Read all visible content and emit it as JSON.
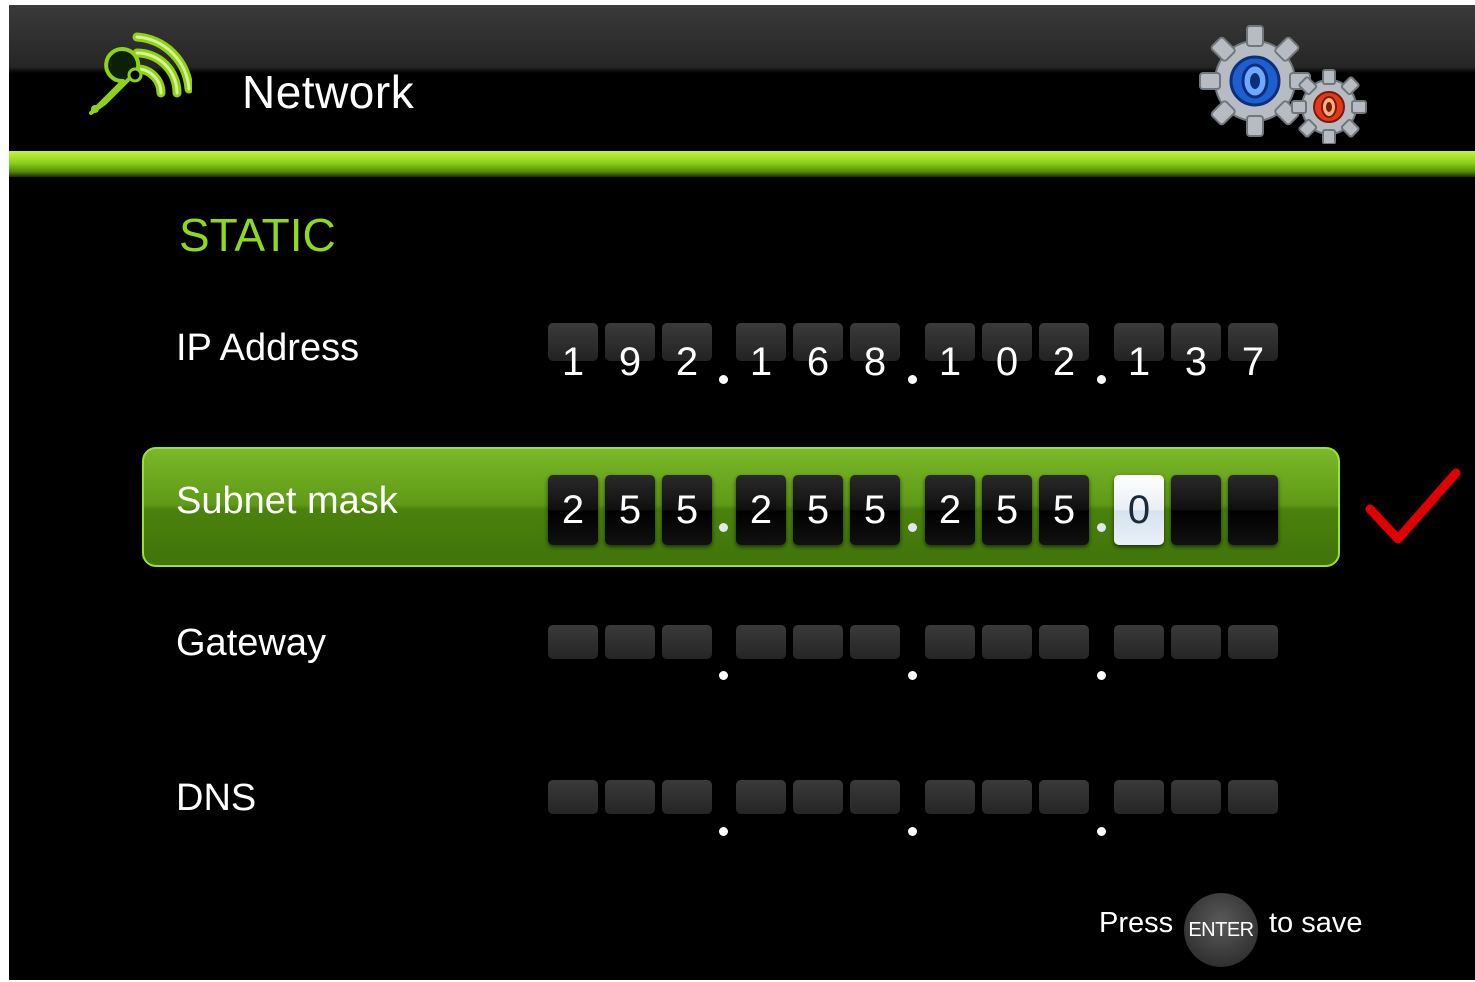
{
  "header": {
    "title": "Network",
    "app_icon": "wifi-wrench-icon",
    "settings_icon": "gears-icon",
    "accent_color": "#8ed11b"
  },
  "mode": "STATIC",
  "fields": {
    "ip": {
      "label": "IP Address",
      "digits": [
        "1",
        "9",
        "2",
        "1",
        "6",
        "8",
        "1",
        "0",
        "2",
        "1",
        "3",
        "7"
      ]
    },
    "subnet": {
      "label": "Subnet mask",
      "digits": [
        "2",
        "5",
        "5",
        "2",
        "5",
        "5",
        "2",
        "5",
        "5",
        "0",
        "",
        ""
      ],
      "active_index": 9,
      "status_icon": "checkmark-icon",
      "status_color": "#e00000"
    },
    "gateway": {
      "label": "Gateway",
      "digits": [
        "",
        "",
        "",
        "",
        "",
        "",
        "",
        "",
        "",
        "",
        "",
        ""
      ]
    },
    "dns": {
      "label": "DNS",
      "digits": [
        "",
        "",
        "",
        "",
        "",
        "",
        "",
        "",
        "",
        "",
        "",
        ""
      ]
    }
  },
  "footer": {
    "press": "Press",
    "enter": "ENTER",
    "to_save": "to save"
  }
}
